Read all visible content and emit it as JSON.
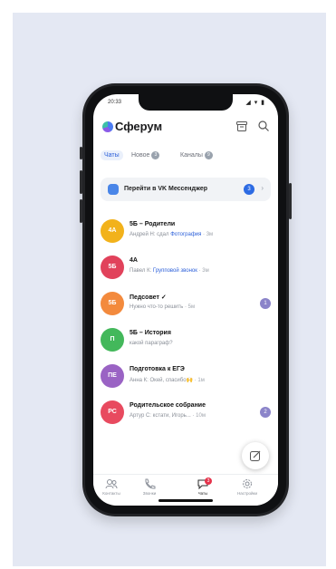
{
  "status_bar": {
    "time": "20:33",
    "icons": "◢ ▾ ▮"
  },
  "app": {
    "name": "Сферум"
  },
  "tabs": [
    {
      "label": "Чаты",
      "count": ""
    },
    {
      "label": "Новое",
      "count": "3"
    },
    {
      "label": "Каналы",
      "count": "9"
    }
  ],
  "banner": {
    "text": "Перейти в VK Мессенджер",
    "count": "3"
  },
  "chats": [
    {
      "initials": "4А",
      "color": "#f2b21b",
      "title": "5Б – Родители",
      "preview_prefix": "Андрей Н: сдал ",
      "preview_link": "Фотография",
      "time": "3м",
      "unread": ""
    },
    {
      "initials": "5Б",
      "color": "#e1425b",
      "title": "4А",
      "preview_prefix": "Павел К: ",
      "preview_link": "Групповой звонок",
      "time": "3м",
      "unread": ""
    },
    {
      "initials": "5Б",
      "color": "#f38a3d",
      "title": "Педсовет ✓",
      "preview_prefix": "Нужно что-то решить",
      "preview_link": "",
      "time": "5м",
      "unread": "1"
    },
    {
      "initials": "П",
      "color": "#43b85b",
      "title": "5Б – История",
      "preview_prefix": "какой параграф?",
      "preview_link": "",
      "time": "",
      "unread": ""
    },
    {
      "initials": "ПЕ",
      "color": "#9a63c4",
      "title": "Подготовка к ЕГЭ",
      "preview_prefix": "Анна К: Окей, спасибо🙌",
      "preview_link": "",
      "time": "1м",
      "unread": ""
    },
    {
      "initials": "РС",
      "color": "#e84a5f",
      "title": "Родительское собрание",
      "preview_prefix": "Артур С: кстати, Игорь...",
      "preview_link": "",
      "time": "10м",
      "unread": "2"
    }
  ],
  "tabbar": [
    {
      "label": "Контакты",
      "icon": "contacts-icon"
    },
    {
      "label": "Звонки",
      "icon": "phone-icon"
    },
    {
      "label": "Чаты",
      "icon": "chat-icon",
      "badge": "3"
    },
    {
      "label": "Настройки",
      "icon": "gear-icon"
    }
  ]
}
